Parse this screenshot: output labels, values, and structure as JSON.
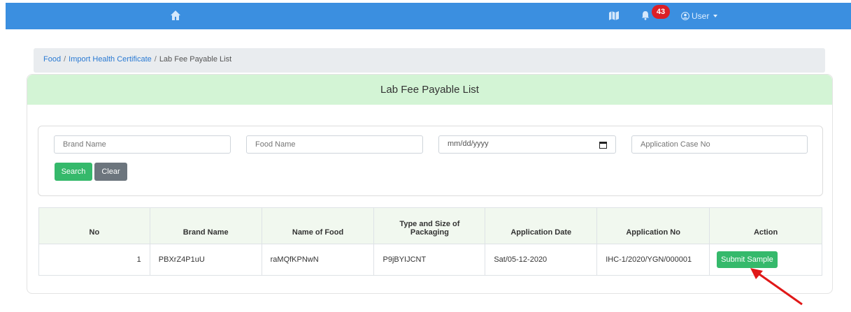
{
  "topbar": {
    "notification_count": "43",
    "user_label": "User"
  },
  "breadcrumb": {
    "item1": "Food",
    "item2": "Import Health Certificate",
    "item3": "Lab Fee Payable List"
  },
  "card": {
    "title": "Lab Fee Payable List"
  },
  "search": {
    "brand_placeholder": "Brand Name",
    "food_placeholder": "Food Name",
    "date_placeholder": "mm/dd/yyyy",
    "case_placeholder": "Application Case No",
    "search_label": "Search",
    "clear_label": "Clear"
  },
  "table": {
    "headers": {
      "no": "No",
      "brand": "Brand Name",
      "food": "Name of Food",
      "packaging": "Type and Size of Packaging",
      "date": "Application Date",
      "app_no": "Application No",
      "action": "Action"
    },
    "rows": [
      {
        "no": "1",
        "brand": "PBXrZ4P1uU",
        "food": "raMQfKPNwN",
        "packaging": "P9jBYIJCNT",
        "date": "Sat/05-12-2020",
        "app_no": "IHC-1/2020/YGN/000001",
        "action": "Submit Sample"
      }
    ]
  },
  "colors": {
    "topbar": "#3b8fe0",
    "card_header": "#d3f4d5",
    "success": "#35b96b",
    "secondary": "#6c757d",
    "badge": "#dc1f26",
    "annotation_arrow": "#e01818"
  },
  "icons": [
    "home-icon",
    "map-icon",
    "bell-icon",
    "user-circle-icon",
    "caret-down-icon",
    "calendar-icon"
  ]
}
